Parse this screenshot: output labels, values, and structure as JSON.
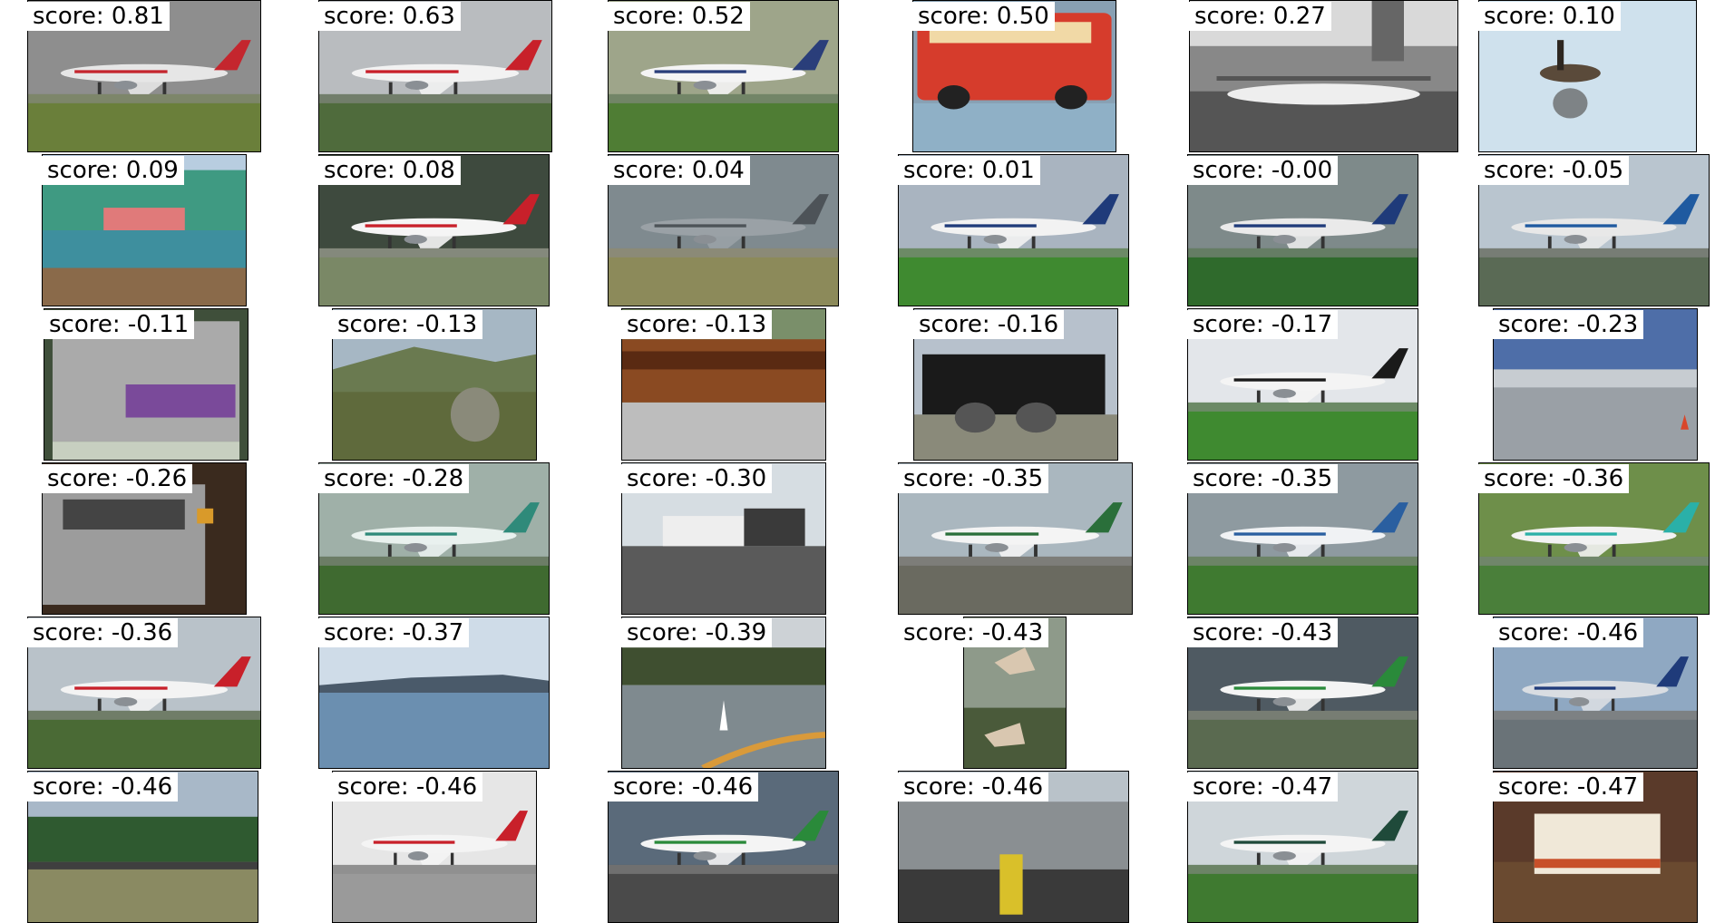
{
  "items": [
    {
      "score": "score: 0.81",
      "scene": "airplane",
      "sky": "#8e8e8e",
      "ground": "#6a7f3a",
      "body": "#e6e6e6",
      "accent": "#c4262e"
    },
    {
      "score": "score: 0.63",
      "scene": "airplane",
      "sky": "#b9bcbf",
      "ground": "#4f6b3c",
      "body": "#f2f2f2",
      "accent": "#c8202a"
    },
    {
      "score": "score: 0.52",
      "scene": "airplane",
      "sky": "#9ea58a",
      "ground": "#4f7d34",
      "body": "#f4f4f4",
      "accent": "#2a3e7a"
    },
    {
      "score": "score: 0.50",
      "scene": "bus",
      "sky": "#88a0b3",
      "ground": "#8fb0c6",
      "body": "#d63c2c",
      "accent": "#f1d9a6"
    },
    {
      "score": "score: 0.27",
      "scene": "airport_bw",
      "sky": "#d9d9d9",
      "ground": "#555555",
      "body": "#eeeeee",
      "accent": "#222222"
    },
    {
      "score": "score: 0.10",
      "scene": "bird_water",
      "sky": "#cfe1ed",
      "ground": "#b7d2e4",
      "body": "#5a4a3a",
      "accent": "#2d2620"
    },
    {
      "score": "score: 0.09",
      "scene": "resort",
      "sky": "#b8cde0",
      "ground": "#3e8f9e",
      "body": "#3f9a82",
      "accent": "#e07a7a"
    },
    {
      "score": "score: 0.08",
      "scene": "airplane",
      "sky": "#3e4a3e",
      "ground": "#7a8866",
      "body": "#f5f5f5",
      "accent": "#c8202a"
    },
    {
      "score": "score: 0.04",
      "scene": "airplane",
      "sky": "#7f8a8f",
      "ground": "#8c8a5a",
      "body": "#9aa1a6",
      "accent": "#4d5358"
    },
    {
      "score": "score: 0.01",
      "scene": "airplane",
      "sky": "#a9b4c0",
      "ground": "#3f8a30",
      "body": "#f2f2f2",
      "accent": "#1f3b7a"
    },
    {
      "score": "score: -0.00",
      "scene": "airplane",
      "sky": "#7e8a8a",
      "ground": "#2f6a2c",
      "body": "#eaeaea",
      "accent": "#1f3b7a"
    },
    {
      "score": "score: -0.05",
      "scene": "airplane",
      "sky": "#b9c5cf",
      "ground": "#5a6a55",
      "body": "#e8e8e8",
      "accent": "#1f5aa0"
    },
    {
      "score": "score: -0.11",
      "scene": "monitor",
      "sky": "#c7cfc0",
      "ground": "#3f4f3a",
      "body": "#aaaaaa",
      "accent": "#7a4a9a"
    },
    {
      "score": "score: -0.13",
      "scene": "landscape",
      "sky": "#a6b7c4",
      "ground": "#5f6a3c",
      "body": "#8a8a7a",
      "accent": "#3a3a2a"
    },
    {
      "score": "score: -0.13",
      "scene": "train",
      "sky": "#7a8f6a",
      "ground": "#bdbdbd",
      "body": "#8a4a22",
      "accent": "#5a2a12"
    },
    {
      "score": "score: -0.16",
      "scene": "locomotive",
      "sky": "#b7c1cc",
      "ground": "#8a8a7a",
      "body": "#1a1a1a",
      "accent": "#555555"
    },
    {
      "score": "score: -0.17",
      "scene": "airplane",
      "sky": "#e3e6ea",
      "ground": "#3f8a30",
      "body": "#f4f4f4",
      "accent": "#1a1a1a"
    },
    {
      "score": "score: -0.23",
      "scene": "tarmac",
      "sky": "#4e6ea8",
      "ground": "#9aa0a6",
      "body": "#c7ccd1",
      "accent": "#d9462a"
    },
    {
      "score": "score: -0.26",
      "scene": "subway",
      "sky": "#3a2a1e",
      "ground": "#1a1a1a",
      "body": "#9c9c9c",
      "accent": "#d99a2a"
    },
    {
      "score": "score: -0.28",
      "scene": "airplane",
      "sky": "#9fb0a8",
      "ground": "#3f6a30",
      "body": "#e9f1ee",
      "accent": "#2f8a7a"
    },
    {
      "score": "score: -0.30",
      "scene": "bus_terminal",
      "sky": "#d6dde2",
      "ground": "#5a5a5a",
      "body": "#eeeeee",
      "accent": "#3a3a3a"
    },
    {
      "score": "score: -0.35",
      "scene": "airplane",
      "sky": "#aab7bf",
      "ground": "#6a6a60",
      "body": "#f4f4f4",
      "accent": "#2a6f3a"
    },
    {
      "score": "score: -0.35",
      "scene": "airplane",
      "sky": "#8e9aa0",
      "ground": "#3f7a30",
      "body": "#f0f2f4",
      "accent": "#2a5fa0"
    },
    {
      "score": "score: -0.36",
      "scene": "airplane",
      "sky": "#6e8f4a",
      "ground": "#4a7f3a",
      "body": "#f2f2f2",
      "accent": "#2ab0a8"
    },
    {
      "score": "score: -0.36",
      "scene": "airplane",
      "sky": "#b9c2c9",
      "ground": "#4a6a35",
      "body": "#f3f3f3",
      "accent": "#c8202a"
    },
    {
      "score": "score: -0.37",
      "scene": "lake",
      "sky": "#cfdce8",
      "ground": "#6b8fb0",
      "body": "#4a5a6a",
      "accent": "#3a3a3a"
    },
    {
      "score": "score: -0.39",
      "scene": "lake_boat",
      "sky": "#cdd2d6",
      "ground": "#7f8a8f",
      "body": "#3f4f30",
      "accent": "#d99a3a"
    },
    {
      "score": "score: -0.43",
      "scene": "birds",
      "sky": "#8e9a8a",
      "ground": "#4a5a3a",
      "body": "#d9c7b0",
      "accent": "#6a5a4a"
    },
    {
      "score": "score: -0.43",
      "scene": "airplane",
      "sky": "#4f5a62",
      "ground": "#5a6a50",
      "body": "#f4f4f4",
      "accent": "#2a8a3a"
    },
    {
      "score": "score: -0.46",
      "scene": "airplane",
      "sky": "#8fa8c2",
      "ground": "#6a7378",
      "body": "#d9dde2",
      "accent": "#1f3b7a"
    },
    {
      "score": "score: -0.46",
      "scene": "airfield_trees",
      "sky": "#a8b8c8",
      "ground": "#8a8a62",
      "body": "#2f5a30",
      "accent": "#3f3f3f"
    },
    {
      "score": "score: -0.46",
      "scene": "airplane",
      "sky": "#e6e6e6",
      "ground": "#9a9a9a",
      "body": "#f4f4f4",
      "accent": "#c8202a"
    },
    {
      "score": "score: -0.46",
      "scene": "airplane",
      "sky": "#5a6a7a",
      "ground": "#4a4a4a",
      "body": "#f4f4f4",
      "accent": "#2a8a3a"
    },
    {
      "score": "score: -0.46",
      "scene": "carrier",
      "sky": "#b9c2c9",
      "ground": "#3a3a3a",
      "body": "#8a8f92",
      "accent": "#d9c02a"
    },
    {
      "score": "score: -0.47",
      "scene": "airplane",
      "sky": "#cfd6da",
      "ground": "#3f7a30",
      "body": "#f4f4f4",
      "accent": "#1f4a3a"
    },
    {
      "score": "score: -0.47",
      "scene": "bus_yard",
      "sky": "#5a3a2a",
      "ground": "#6a4a30",
      "body": "#f0e8d8",
      "accent": "#c8502a"
    }
  ]
}
